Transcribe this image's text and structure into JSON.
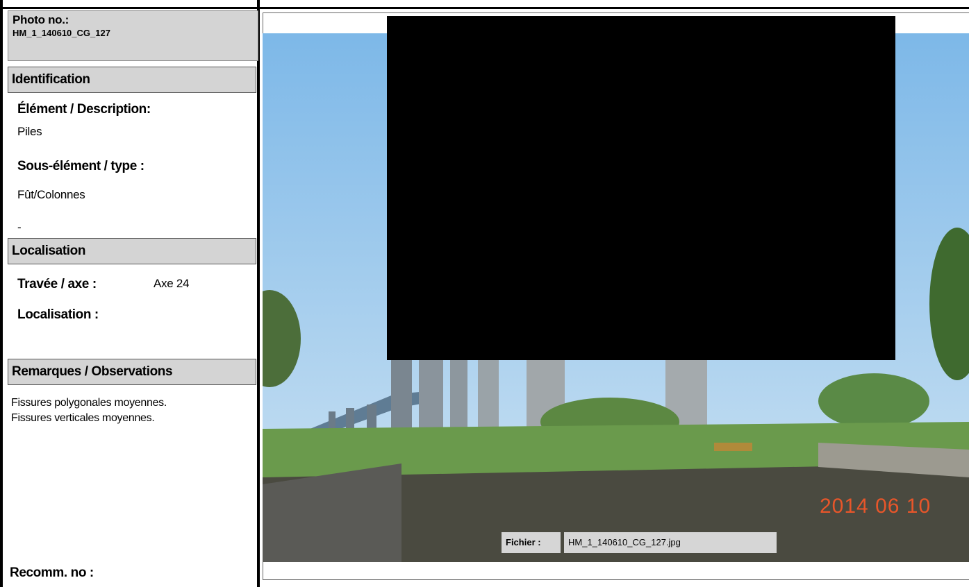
{
  "photo": {
    "label": "Photo no.:",
    "number": "HM_1_140610_CG_127"
  },
  "identification": {
    "heading": "Identification",
    "element_label": "Élément / Description:",
    "element_value": "Piles",
    "subelement_label": "Sous-élément / type :",
    "subelement_value": "Fût/Colonnes",
    "extra": "-"
  },
  "localisation": {
    "heading": "Localisation",
    "travee_label": "Travée / axe :",
    "travee_value": "Axe 24",
    "localisation_label": "Localisation :"
  },
  "remarques": {
    "heading": "Remarques / Observations",
    "line1": "Fissures polygonales moyennes.",
    "line2": "Fissures verticales moyennes."
  },
  "recommandation": {
    "label": "Recomm. no :"
  },
  "image": {
    "date_stamp": "2014 06 10",
    "file_label": "Fichier :",
    "file_name": "HM_1_140610_CG_127.jpg"
  },
  "colors": {
    "section_bg": "#d4d4d4",
    "date_stamp": "#e8562a",
    "sky": "#8ec3ea",
    "redaction": "#000000"
  }
}
